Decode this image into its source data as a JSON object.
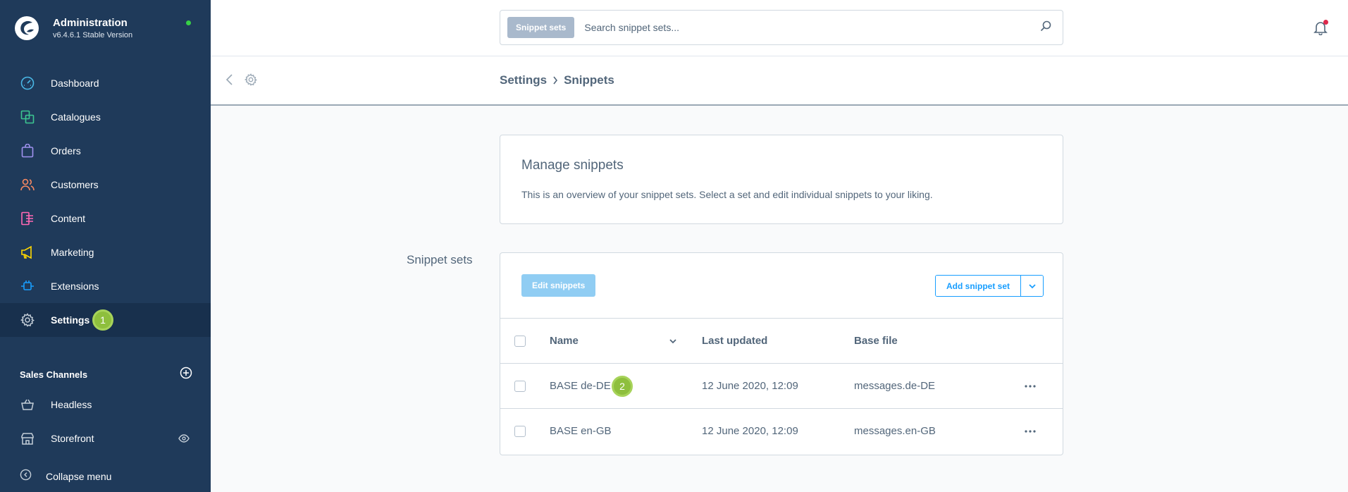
{
  "sidebar": {
    "title": "Administration",
    "version": "v6.4.6.1 Stable Version",
    "items": [
      {
        "label": "Dashboard"
      },
      {
        "label": "Catalogues"
      },
      {
        "label": "Orders"
      },
      {
        "label": "Customers"
      },
      {
        "label": "Content"
      },
      {
        "label": "Marketing"
      },
      {
        "label": "Extensions"
      },
      {
        "label": "Settings",
        "badge": "1"
      }
    ],
    "sales_channels_title": "Sales Channels",
    "sales_channels": [
      {
        "label": "Headless"
      },
      {
        "label": "Storefront"
      }
    ],
    "collapse_label": "Collapse menu"
  },
  "topbar": {
    "search_tag": "Snippet sets",
    "search_placeholder": "Search snippet sets..."
  },
  "breadcrumb": {
    "parent": "Settings",
    "current": "Snippets"
  },
  "intro": {
    "title": "Manage snippets",
    "description": "This is an overview of your snippet sets. Select a set and edit individual snippets to your liking."
  },
  "snippet_sets": {
    "section_label": "Snippet sets",
    "edit_button": "Edit snippets",
    "add_button": "Add snippet set",
    "columns": {
      "name": "Name",
      "last_updated": "Last updated",
      "base_file": "Base file"
    },
    "rows": [
      {
        "name": "BASE de-DE",
        "last_updated": "12 June 2020, 12:09",
        "base_file": "messages.de-DE",
        "badge": "2"
      },
      {
        "name": "BASE en-GB",
        "last_updated": "12 June 2020, 12:09",
        "base_file": "messages.en-GB"
      }
    ]
  },
  "colors": {
    "sidebar_bg": "#1f3a5a",
    "accent": "#189eff",
    "badge": "#8ebf3d",
    "status_online": "#37d046",
    "notification": "#de294c"
  }
}
